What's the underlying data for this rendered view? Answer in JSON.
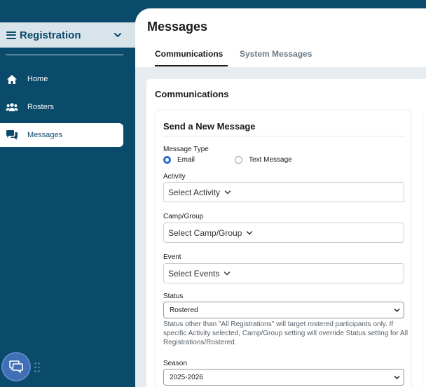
{
  "sidebar": {
    "title": "Registration",
    "items": [
      {
        "label": "Home",
        "icon": "home-icon",
        "active": false
      },
      {
        "label": "Rosters",
        "icon": "users-icon",
        "active": false
      },
      {
        "label": "Messages",
        "icon": "chat-bubbles-icon",
        "active": true
      }
    ]
  },
  "header": {
    "title": "Messages",
    "tabs": [
      {
        "label": "Communications",
        "active": true
      },
      {
        "label": "System Messages",
        "active": false
      }
    ]
  },
  "card": {
    "title": "Communications",
    "form": {
      "title": "Send a New Message",
      "message_type": {
        "label": "Message Type",
        "options": [
          {
            "label": "Email",
            "checked": true
          },
          {
            "label": "Text Message",
            "checked": false
          }
        ]
      },
      "activity": {
        "label": "Activity",
        "placeholder": "Select Activity"
      },
      "camp_group": {
        "label": "Camp/Group",
        "placeholder": "Select Camp/Group"
      },
      "event": {
        "label": "Event",
        "placeholder": "Select Events"
      },
      "status": {
        "label": "Status",
        "value": "Rostered",
        "help": "Status other than \"All Registrations\" will target rostered participants only. If specific Activity selected, Camp/Group setting will override Status setting for All Registrations/Rostered."
      },
      "season": {
        "label": "Season",
        "value": "2025-2026"
      }
    }
  },
  "colors": {
    "sidebar_bg": "#0a4a6b",
    "sidebar_header_bg": "#d9e4ea",
    "radio_checked": "#2f6fd6",
    "chat_fab": "#3f6fb5"
  }
}
